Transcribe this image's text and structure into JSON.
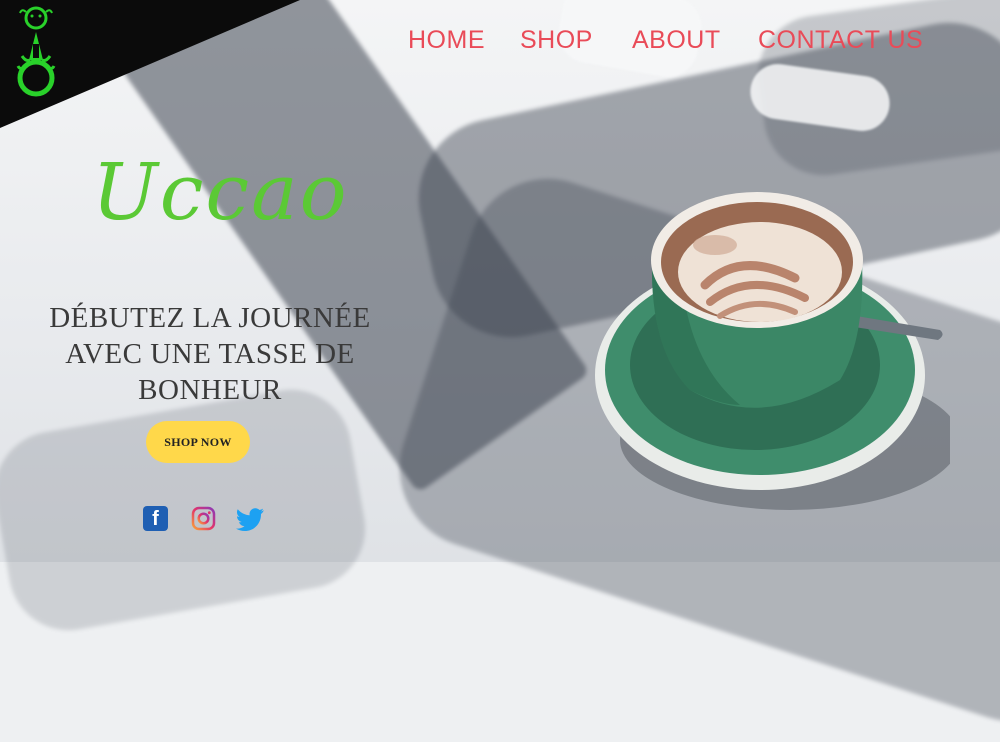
{
  "nav": {
    "items": [
      {
        "label": "HOME"
      },
      {
        "label": "SHOP"
      },
      {
        "label": "ABOUT"
      },
      {
        "label": "CONTACT US"
      }
    ]
  },
  "hero": {
    "brand": "Uccao",
    "tagline_line1": "DÉBUTEZ LA JOURNÉE",
    "tagline_line2": "AVEC UNE TASSE DE",
    "tagline_line3": "BONHEUR",
    "cta_label": "SHOP NOW"
  },
  "social": {
    "icons": [
      "facebook-icon",
      "instagram-icon",
      "twitter-icon"
    ]
  },
  "colors": {
    "nav": "#e94b58",
    "brand": "#5bc935",
    "cta": "#ffd84a",
    "logo": "#29d12a",
    "corner": "#0b0b0b",
    "cup": "#3b8766"
  }
}
